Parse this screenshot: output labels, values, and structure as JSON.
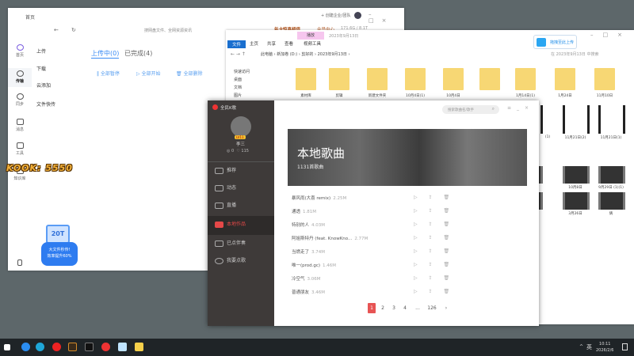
{
  "baidu": {
    "title": "首页",
    "search_placeholder": "搜网盘文件、全网资源资讯",
    "create_team": "+ 创建企业/团队",
    "vip_banner": "年卡惊喜超值",
    "member_center": "会员中心",
    "storage": "171.6G / 8.1T",
    "rail": [
      {
        "label": "首页"
      },
      {
        "label": "传输",
        "active": true
      },
      {
        "label": "同步"
      },
      {
        "label": "消息"
      },
      {
        "label": "工具"
      },
      {
        "label": "知识库"
      }
    ],
    "sub_nav": [
      "上传",
      "下载",
      "云添加",
      "文件快传"
    ],
    "tabs": [
      {
        "label": "上传中(0)",
        "active": true
      },
      {
        "label": "已完成(4)"
      }
    ],
    "actions": [
      "‖ 全部暂停",
      "▷ 全部开始",
      "🗑 全部删除"
    ],
    "promo": {
      "badge": "20T",
      "line1": "大文件秒传!",
      "line2": "效率提升60%"
    }
  },
  "overlay": {
    "kook": "KOOK: 5550"
  },
  "explorer": {
    "context_tab": "播放",
    "title": "2023年9月13日",
    "ribbon": [
      "文件",
      "主页",
      "共享",
      "查看",
      "视频工具"
    ],
    "upload_button": "拖拽至此上传",
    "breadcrumb": [
      "此电脑",
      "新加卷 (D:)",
      "剪好的",
      "2023年9月13日"
    ],
    "search_placeholder": "在 2023年9月13日 中搜索",
    "nav": [
      "快速访问",
      "桌面",
      "文档",
      "图片"
    ],
    "folders": [
      "素材库",
      "剪辑",
      "新建文件夹",
      "10月4日(1)",
      "10月4日",
      "",
      "1月14日(1)",
      "1月24日",
      "11月10日"
    ],
    "row2": [
      "(1)",
      "11月21日(2)",
      "11月21日(1)"
    ],
    "row3": [
      "",
      "10月8日",
      "9月29日 (1)(1)"
    ],
    "row4": [
      "",
      "3月26日",
      "俩"
    ]
  },
  "karaoke": {
    "app_name": "全民K歌",
    "user": {
      "name": "李三",
      "level": "LV11",
      "followers": "0",
      "likes": "115"
    },
    "search_placeholder": "搜索歌曲名/歌手",
    "nav": [
      {
        "label": "推荐"
      },
      {
        "label": "动态"
      },
      {
        "label": "直播"
      },
      {
        "label": "本地作品",
        "active": true
      },
      {
        "label": "已点伴奏"
      },
      {
        "label": "我要点歌"
      }
    ],
    "banner": {
      "title": "本地歌曲",
      "subtitle": "1131首歌曲"
    },
    "songs": [
      {
        "title": "暴风雨(大喜 remix)",
        "size": "2.25M"
      },
      {
        "title": "通透",
        "size": "1.81M"
      },
      {
        "title": "特别的人",
        "size": "4.03M"
      },
      {
        "title": "阿姐斯特丹 (feat. KnowKno...",
        "size": "2.77M"
      },
      {
        "title": "当燃走了",
        "size": "3.74M"
      },
      {
        "title": "唯一(prod.gc)",
        "size": "1.46M"
      },
      {
        "title": "冷空气",
        "size": "3.06M"
      },
      {
        "title": "普通朋友",
        "size": "3.46M"
      }
    ],
    "song_ops": "▷ ⇪ 🗑",
    "pagination": [
      "1",
      "2",
      "3",
      "4",
      "...",
      "126",
      "›"
    ]
  },
  "taskbar": {
    "ime": "英",
    "time": "10:11",
    "date": "2026/2/6",
    "tray": "^"
  }
}
